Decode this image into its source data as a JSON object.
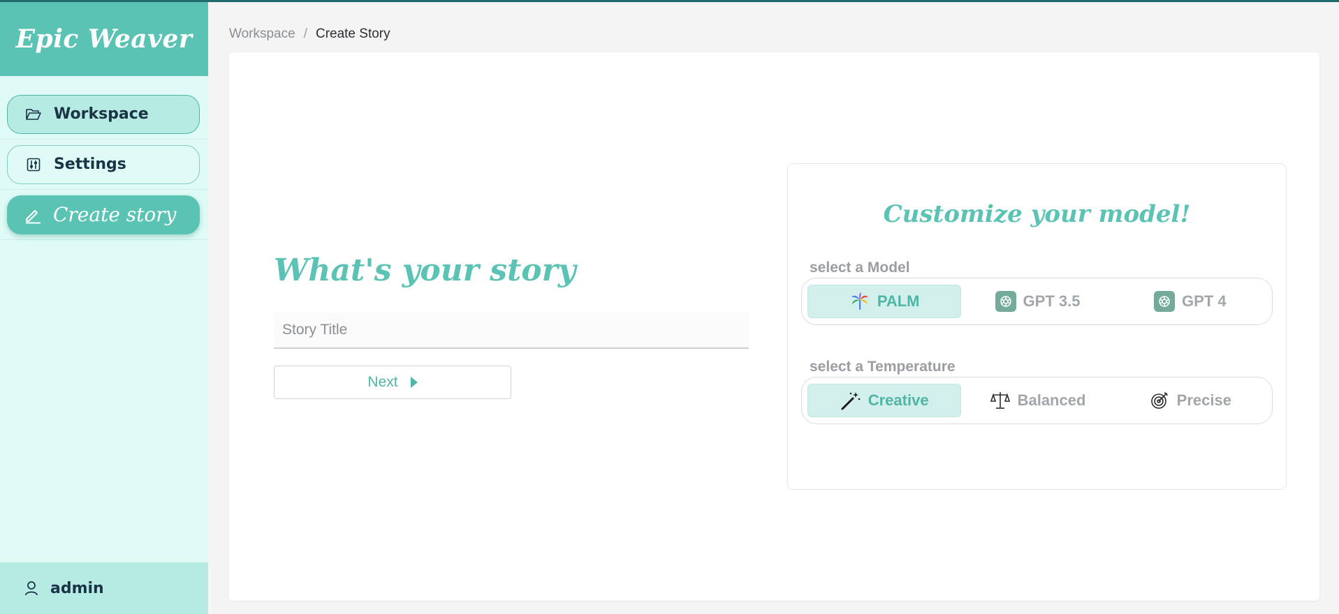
{
  "app": {
    "brand": "Epic Weaver"
  },
  "sidebar": {
    "items": [
      {
        "label": "Workspace",
        "icon": "folder-open-icon",
        "active": true
      },
      {
        "label": "Settings",
        "icon": "sliders-icon",
        "active": false
      },
      {
        "label": "Create story",
        "icon": "pencil-icon",
        "active": false
      }
    ],
    "user": {
      "name": "admin",
      "icon": "user-icon"
    }
  },
  "breadcrumb": {
    "parent": "Workspace",
    "separator": "/",
    "current": "Create Story"
  },
  "story": {
    "heading": "What's your story",
    "title_placeholder": "Story Title",
    "title_value": "",
    "next_label": "Next"
  },
  "customize": {
    "title": "Customize your model!",
    "model_label": "select a Model",
    "models": [
      {
        "label": "PALM",
        "icon": "palm-icon",
        "selected": true
      },
      {
        "label": "GPT 3.5",
        "icon": "openai-icon",
        "selected": false
      },
      {
        "label": "GPT 4",
        "icon": "openai-icon",
        "selected": false
      }
    ],
    "temperature_label": "select a Temperature",
    "temperatures": [
      {
        "label": "Creative",
        "icon": "magic-wand-icon",
        "selected": true
      },
      {
        "label": "Balanced",
        "icon": "scale-icon",
        "selected": false
      },
      {
        "label": "Precise",
        "icon": "target-icon",
        "selected": false
      }
    ]
  },
  "colors": {
    "accent": "#5ac3b3",
    "sidebar_bg": "#e0fbf6",
    "selected_bg": "#d3efeb",
    "topline": "#1f6b6b"
  }
}
